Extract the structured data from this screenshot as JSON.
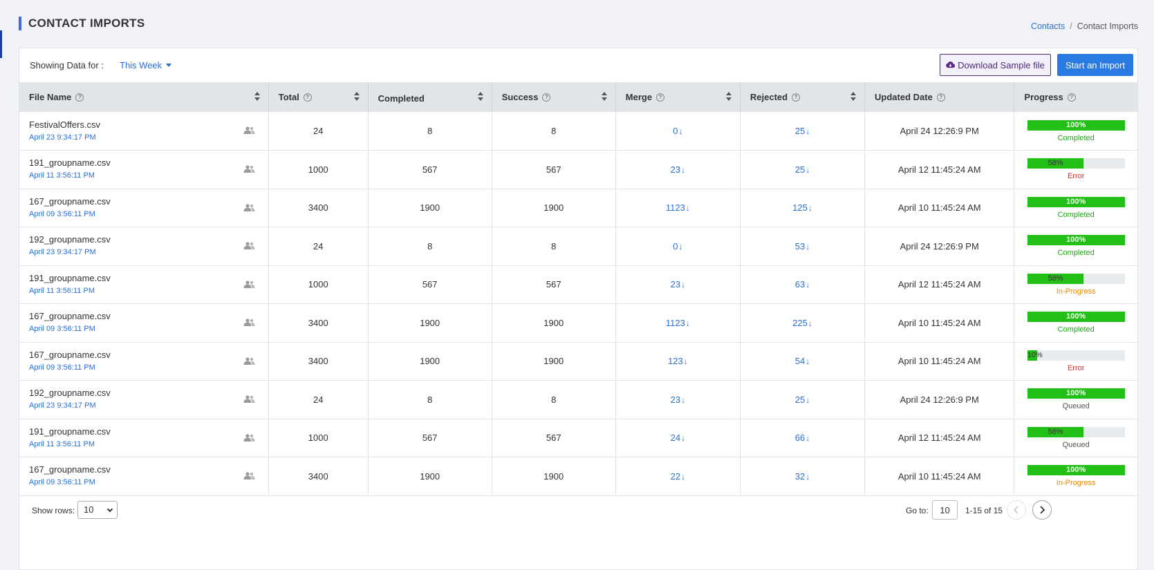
{
  "page": {
    "title": "CONTACT IMPORTS",
    "breadcrumb": {
      "link": "Contacts",
      "separator": "/",
      "current": "Contact Imports"
    }
  },
  "toolbar": {
    "showing_label": "Showing Data for :",
    "period": "This Week",
    "download_label": "Download Sample file",
    "start_label": "Start an Import"
  },
  "table": {
    "headers": {
      "file_name": "File Name",
      "total": "Total",
      "completed": "Completed",
      "success": "Success",
      "merge": "Merge",
      "rejected": "Rejected",
      "updated": "Updated Date",
      "progress": "Progress"
    },
    "rows": [
      {
        "file": "FestivalOffers.csv",
        "date": "April 23 9:34:17 PM",
        "total": "24",
        "completed": "8",
        "success": "8",
        "merge": "0",
        "rejected": "25",
        "updated": "April 24 12:26:9 PM",
        "progress": 100,
        "progress_label": "100%",
        "status": "Completed"
      },
      {
        "file": "191_groupname.csv",
        "date": "April 11 3:56:11 PM",
        "total": "1000",
        "completed": "567",
        "success": "567",
        "merge": "23",
        "rejected": "25",
        "updated": "April 12 11:45:24 AM",
        "progress": 58,
        "progress_label": "58%",
        "status": "Error"
      },
      {
        "file": "167_groupname.csv",
        "date": "April 09 3:56:11 PM",
        "total": "3400",
        "completed": "1900",
        "success": "1900",
        "merge": "1123",
        "rejected": "125",
        "updated": "April 10 11:45:24 AM",
        "progress": 100,
        "progress_label": "100%",
        "status": "Completed"
      },
      {
        "file": "192_groupname.csv",
        "date": "April 23 9:34:17 PM",
        "total": "24",
        "completed": "8",
        "success": "8",
        "merge": "0",
        "rejected": "53",
        "updated": "April 24 12:26:9 PM",
        "progress": 100,
        "progress_label": "100%",
        "status": "Completed"
      },
      {
        "file": "191_groupname.csv",
        "date": "April 11 3:56:11 PM",
        "total": "1000",
        "completed": "567",
        "success": "567",
        "merge": "23",
        "rejected": "63",
        "updated": "April 12 11:45:24 AM",
        "progress": 58,
        "progress_label": "58%",
        "status": "In-Progress"
      },
      {
        "file": "167_groupname.csv",
        "date": "April 09 3:56:11 PM",
        "total": "3400",
        "completed": "1900",
        "success": "1900",
        "merge": "1123",
        "rejected": "225",
        "updated": "April 10 11:45:24 AM",
        "progress": 100,
        "progress_label": "100%",
        "status": "Completed"
      },
      {
        "file": "167_groupname.csv",
        "date": "April 09 3:56:11 PM",
        "total": "3400",
        "completed": "1900",
        "success": "1900",
        "merge": "123",
        "rejected": "54",
        "updated": "April 10 11:45:24 AM",
        "progress": 10,
        "progress_label": "10%",
        "status": "Error"
      },
      {
        "file": "192_groupname.csv",
        "date": "April 23 9:34:17 PM",
        "total": "24",
        "completed": "8",
        "success": "8",
        "merge": "23",
        "rejected": "25",
        "updated": "April 24 12:26:9 PM",
        "progress": 100,
        "progress_label": "100%",
        "status": "Queued"
      },
      {
        "file": "191_groupname.csv",
        "date": "April 11 3:56:11 PM",
        "total": "1000",
        "completed": "567",
        "success": "567",
        "merge": "24",
        "rejected": "66",
        "updated": "April 12 11:45:24 AM",
        "progress": 58,
        "progress_label": "58%",
        "status": "Queued"
      },
      {
        "file": "167_groupname.csv",
        "date": "April 09 3:56:11 PM",
        "total": "3400",
        "completed": "1900",
        "success": "1900",
        "merge": "22",
        "rejected": "32",
        "updated": "April 10 11:45:24 AM",
        "progress": 100,
        "progress_label": "100%",
        "status": "In-Progress"
      }
    ]
  },
  "footer": {
    "show_rows_label": "Show rows:",
    "rows_value": "10",
    "goto_label": "Go to:",
    "goto_value": "10",
    "page_range": "1-15 of 15"
  },
  "colors": {
    "accent": "#3f6ad8",
    "link": "#2a6fd6",
    "progress_fill": "#22c016",
    "completed": "#1fa51a",
    "error": "#d9302c",
    "in_progress": "#e68a00",
    "primary_button": "#2a7ae4"
  },
  "icons": {
    "help": "question-circle-icon",
    "users": "users-icon",
    "download": "cloud-download-icon",
    "sort": "sort-icon",
    "arrow": "arrow-down-icon"
  }
}
